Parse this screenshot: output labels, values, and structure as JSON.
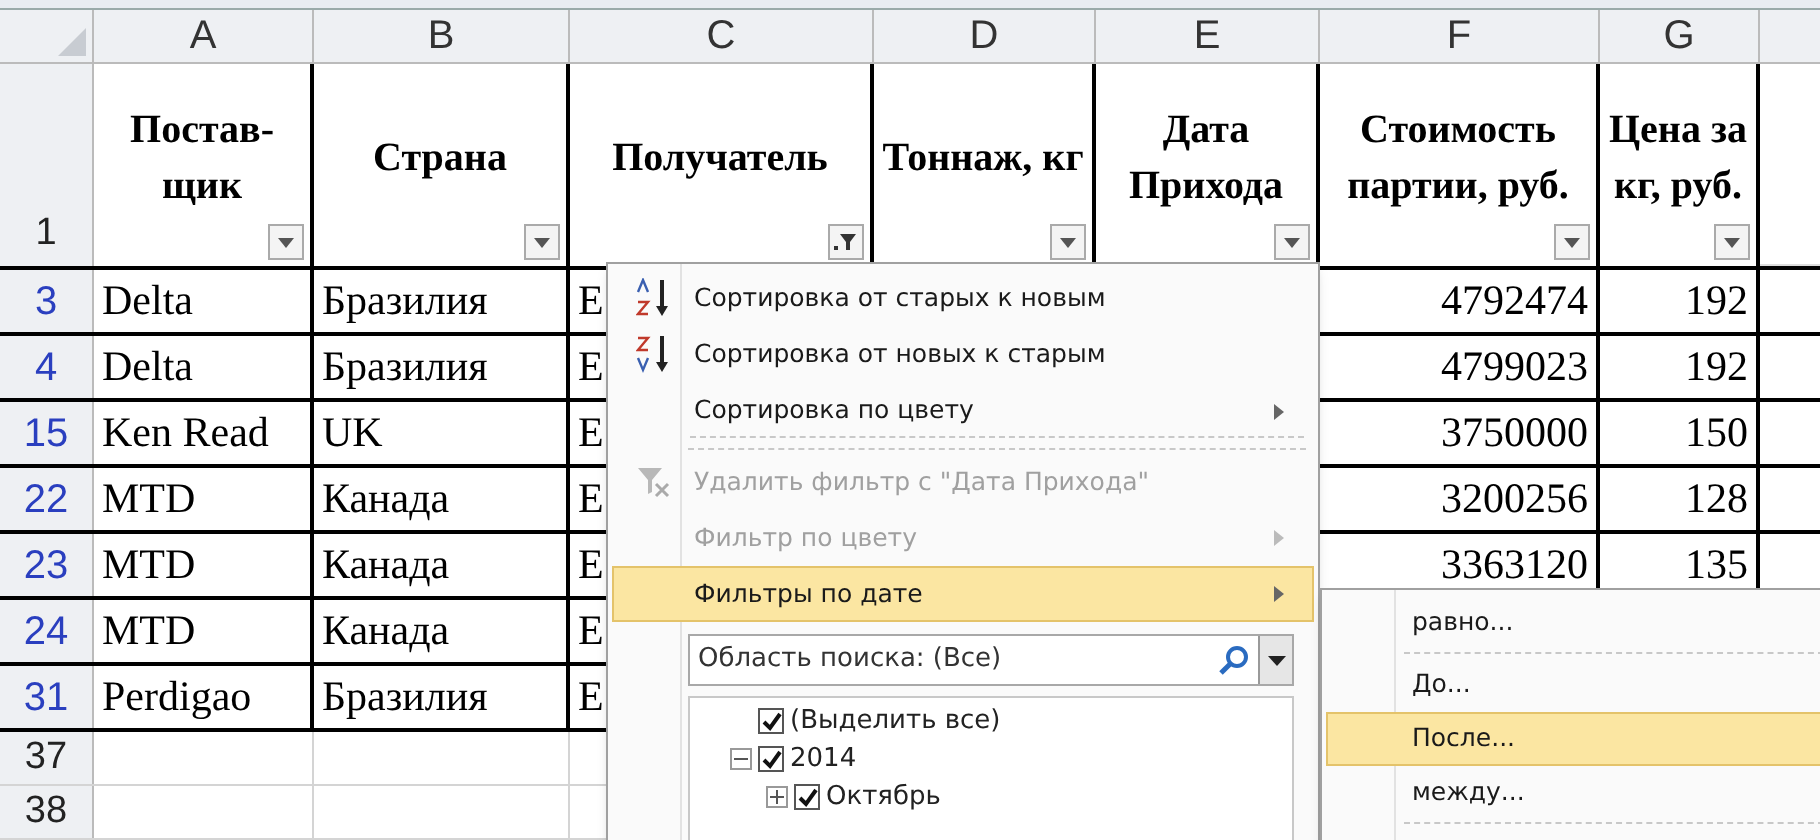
{
  "columns": [
    {
      "letter": "A",
      "heading": "Постав-щик",
      "filtered": false
    },
    {
      "letter": "B",
      "heading": "Страна",
      "filtered": false
    },
    {
      "letter": "C",
      "heading": "Получатель",
      "filtered": true
    },
    {
      "letter": "D",
      "heading": "Тоннаж, кг",
      "filtered": false
    },
    {
      "letter": "E",
      "heading": "Дата Прихода",
      "filtered": false
    },
    {
      "letter": "F",
      "heading": "Стоимость партии, руб.",
      "filtered": false
    },
    {
      "letter": "G",
      "heading": "Цена за кг, руб.",
      "filtered": false
    }
  ],
  "header_row_number": "1",
  "rows": [
    {
      "number": "3",
      "filtered": true,
      "a": "Delta",
      "b": "Бразилия",
      "c": "E",
      "f": "4792474",
      "g": "192"
    },
    {
      "number": "4",
      "filtered": true,
      "a": "Delta",
      "b": "Бразилия",
      "c": "E",
      "f": "4799023",
      "g": "192"
    },
    {
      "number": "15",
      "filtered": true,
      "a": "Ken Read",
      "b": "UK",
      "c": "E",
      "f": "3750000",
      "g": "150"
    },
    {
      "number": "22",
      "filtered": true,
      "a": "MTD",
      "b": "Канада",
      "c": "E",
      "f": "3200256",
      "g": "128"
    },
    {
      "number": "23",
      "filtered": true,
      "a": "MTD",
      "b": "Канада",
      "c": "E",
      "f": "3363120",
      "g": "135"
    },
    {
      "number": "24",
      "filtered": true,
      "a": "MTD",
      "b": "Канада",
      "c": "E"
    },
    {
      "number": "31",
      "filtered": true,
      "a": "Perdigao",
      "b": "Бразилия",
      "c": "E"
    },
    {
      "number": "37",
      "filtered": false
    },
    {
      "number": "38",
      "filtered": false
    }
  ],
  "filter_menu": {
    "items": [
      {
        "label": "Сортировка от старых к новым",
        "kind": "sort-asc",
        "disabled": false,
        "submenu": false,
        "selected": false,
        "separator_after": false
      },
      {
        "label": "Сортировка от новых к старым",
        "kind": "sort-desc",
        "disabled": false,
        "submenu": false,
        "selected": false,
        "separator_after": false
      },
      {
        "label": "Сортировка по цвету",
        "disabled": false,
        "submenu": true,
        "selected": false,
        "separator_after": true
      },
      {
        "label": "Удалить фильтр с \"Дата Прихода\"",
        "kind": "clear-filter",
        "disabled": true,
        "submenu": false,
        "selected": false,
        "separator_after": false
      },
      {
        "label": "Фильтр по цвету",
        "disabled": true,
        "submenu": true,
        "selected": false,
        "separator_after": false
      },
      {
        "label": "Фильтры по дате",
        "disabled": false,
        "submenu": true,
        "selected": true,
        "separator_after": false
      }
    ],
    "search": {
      "placeholder": "Область поиска: (Все)"
    },
    "tree": [
      {
        "label": "(Выделить все)",
        "checked": true
      },
      {
        "label": "2014",
        "checked": true,
        "expanded": true,
        "children": [
          {
            "label": "Октябрь",
            "checked": true,
            "expanded": false
          }
        ]
      }
    ]
  },
  "date_submenu": {
    "items": [
      {
        "label": "равно...",
        "selected": false,
        "separator_after": true
      },
      {
        "label": "До...",
        "selected": false,
        "separator_after": false
      },
      {
        "label": "После...",
        "selected": true,
        "separator_after": false
      },
      {
        "label": "между...",
        "selected": false,
        "separator_after": true
      }
    ]
  }
}
